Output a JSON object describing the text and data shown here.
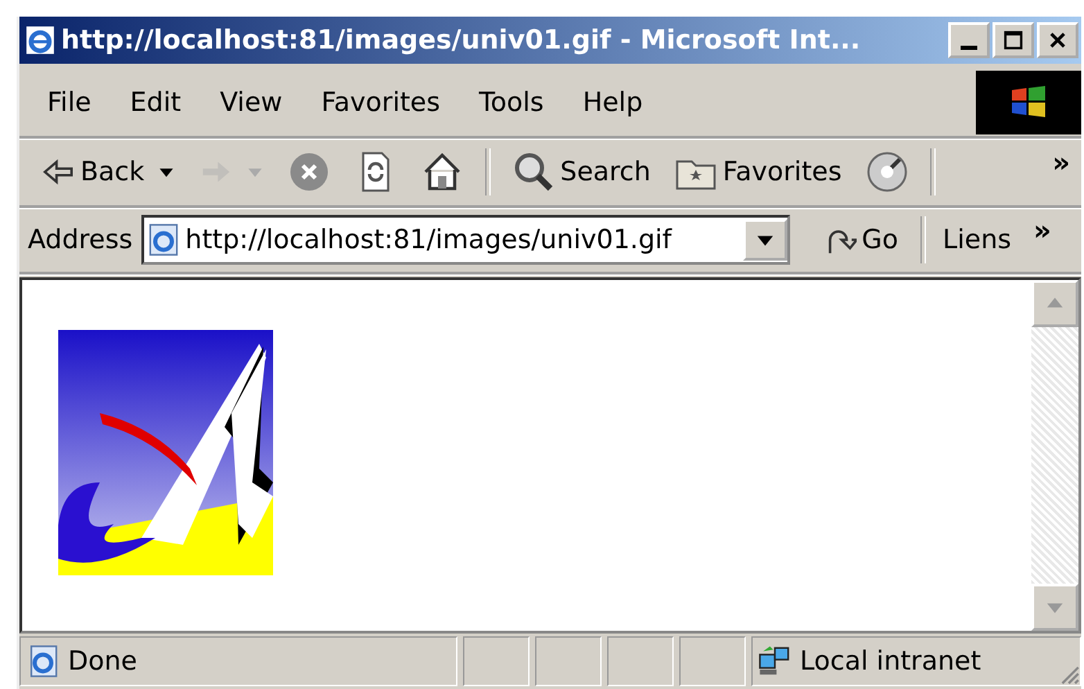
{
  "window": {
    "title": "http://localhost:81/images/univ01.gif - Microsoft Int..."
  },
  "menu": [
    "File",
    "Edit",
    "View",
    "Favorites",
    "Tools",
    "Help"
  ],
  "toolbar": {
    "buttons": [
      {
        "kind": "back",
        "label": "Back",
        "disabled": false
      },
      {
        "kind": "forward",
        "disabled": true
      },
      {
        "kind": "stop",
        "disabled": false
      },
      {
        "kind": "refresh",
        "disabled": false
      },
      {
        "kind": "home",
        "disabled": false
      },
      {
        "kind": "search",
        "label": "Search",
        "disabled": false
      },
      {
        "kind": "favorites",
        "label": "Favorites",
        "disabled": false
      },
      {
        "kind": "media",
        "disabled": false
      }
    ],
    "overflow": "»"
  },
  "address_bar": {
    "label": "Address",
    "value": "http://localhost:81/images/univ01.gif",
    "go": "Go",
    "links": "Liens",
    "overflow": "»"
  },
  "status_bar": {
    "text": "Done",
    "zone": "Local intranet"
  }
}
